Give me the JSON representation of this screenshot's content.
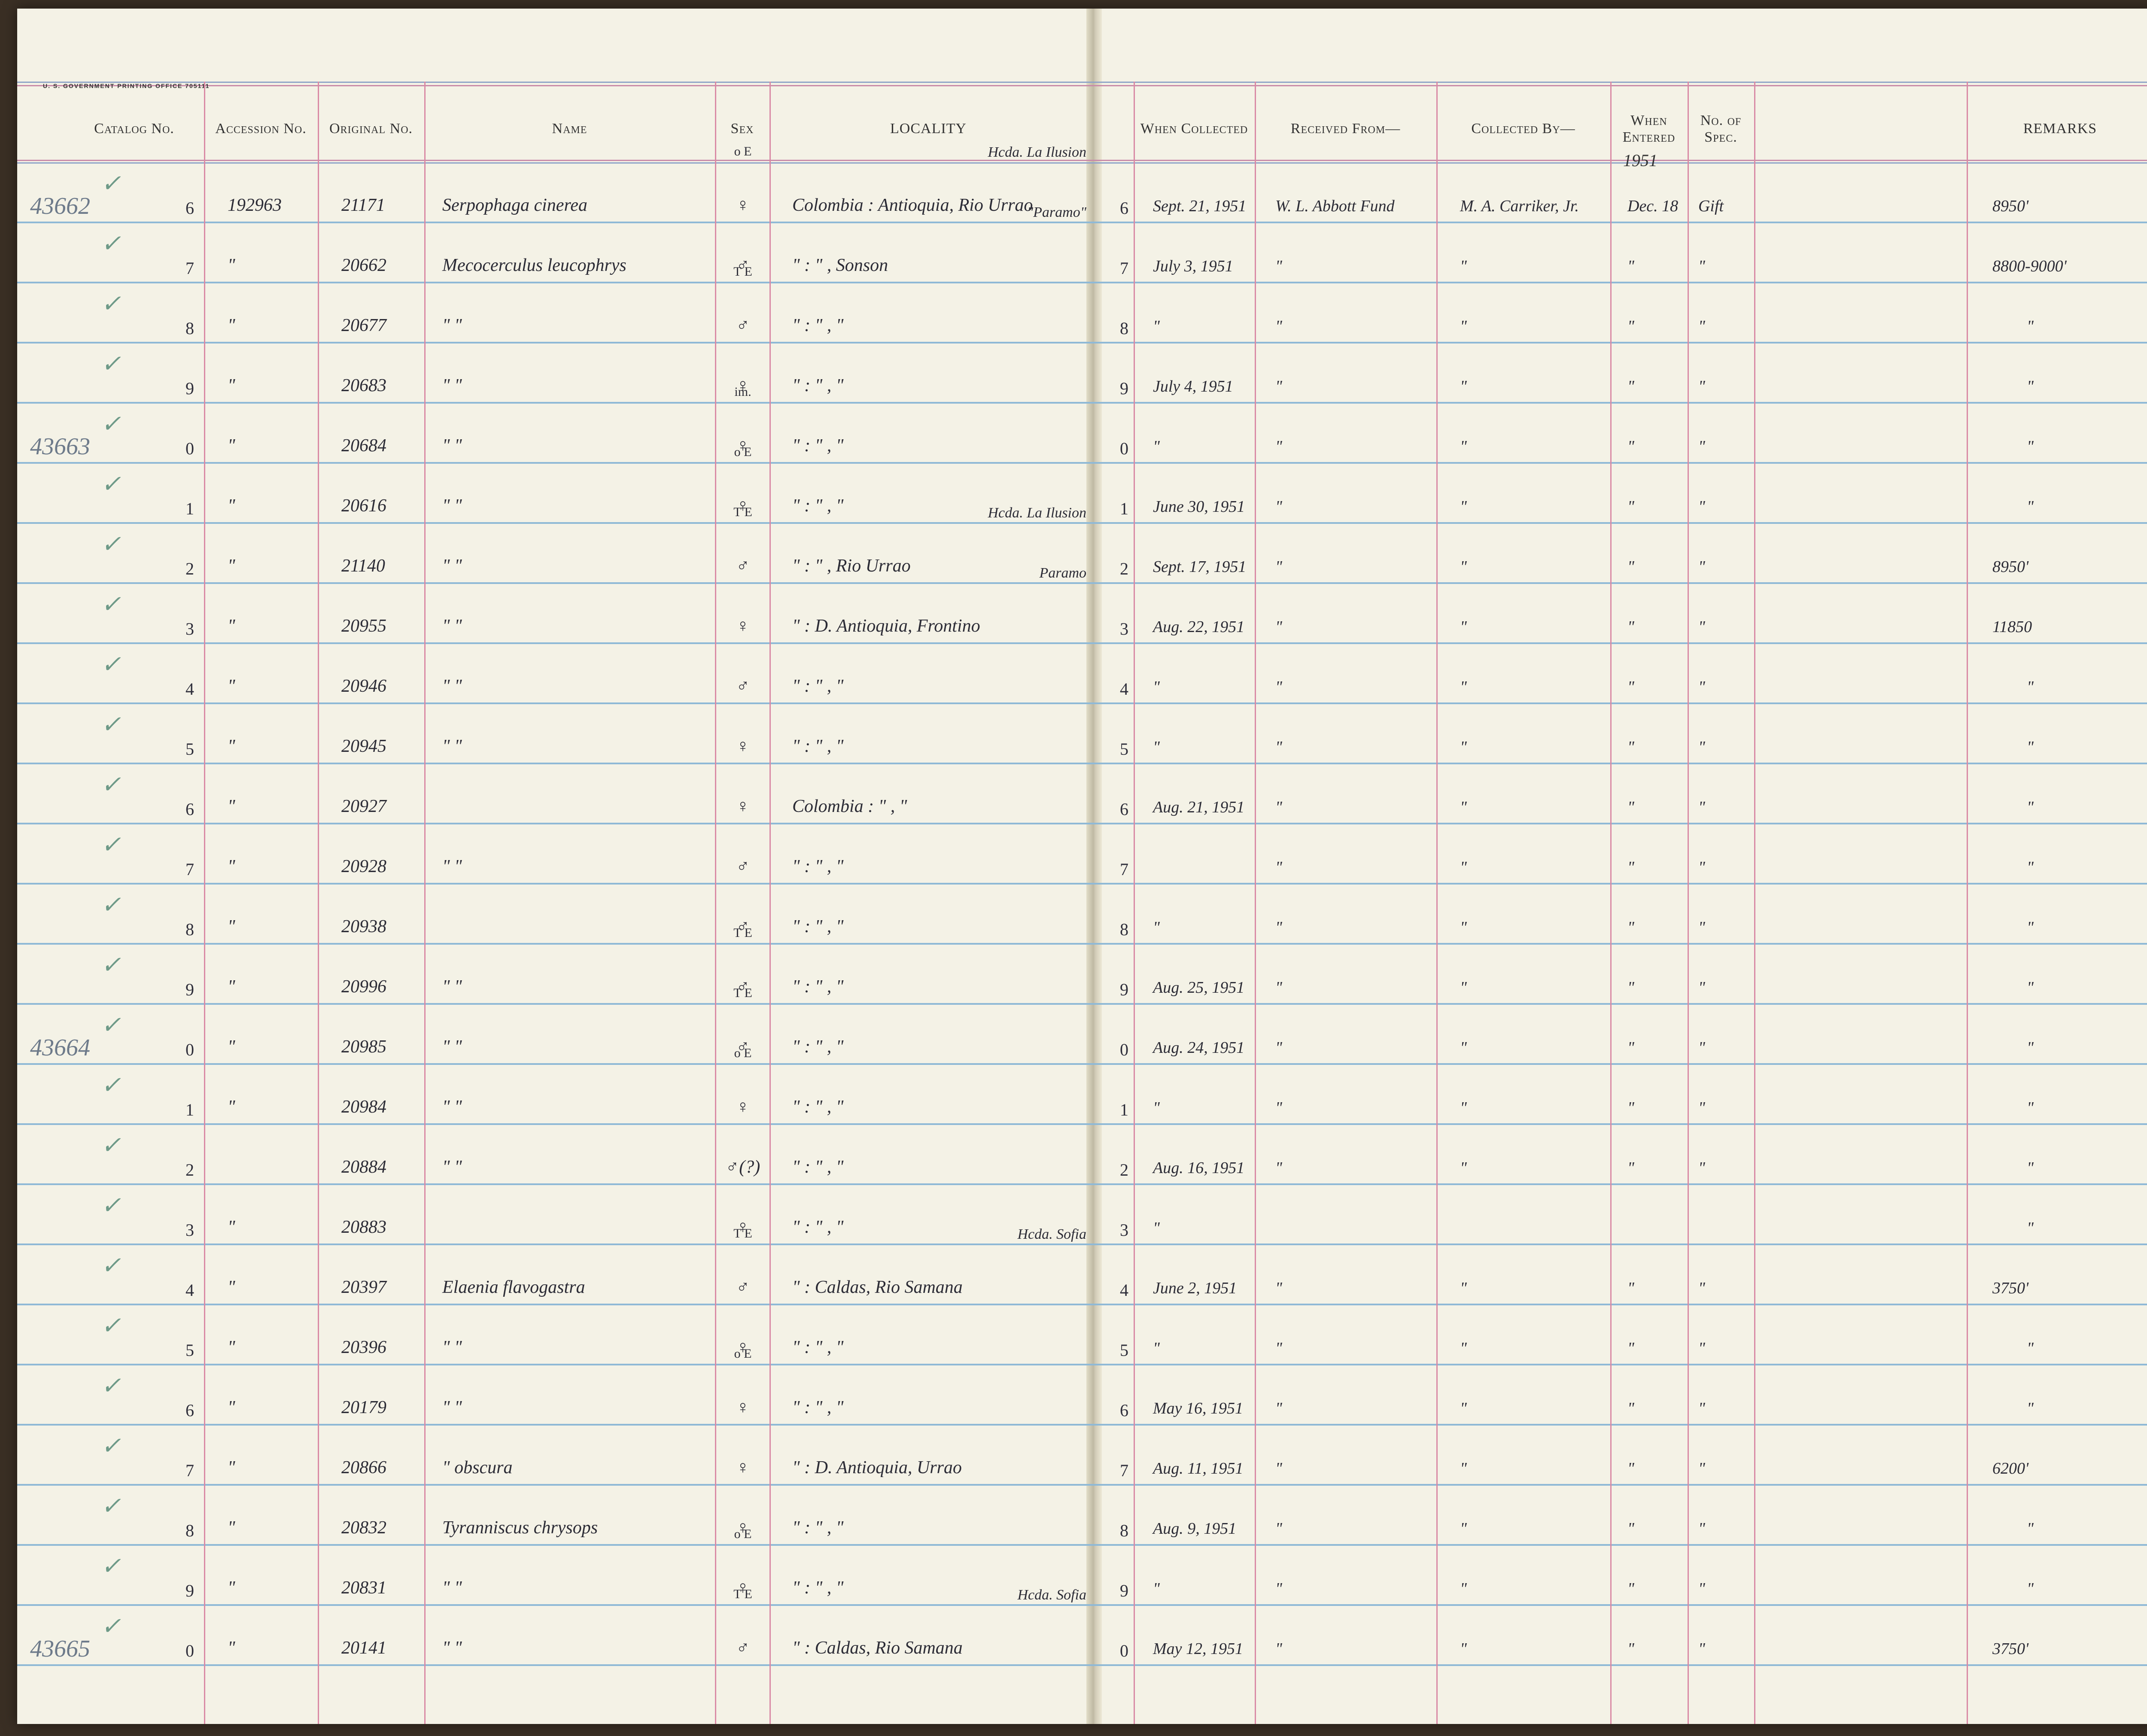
{
  "printer": "U. S. GOVERNMENT PRINTING OFFICE   705111",
  "headers": {
    "catalog": "Catalog No.",
    "accession": "Accession No.",
    "original": "Original No.",
    "name": "Name",
    "sex": "Sex",
    "locality": "LOCALITY",
    "when_collected": "When Collected",
    "received_from": "Received From—",
    "collected_by": "Collected By—",
    "when_entered": "When Entered",
    "no_spec": "No. of Spec.",
    "remarks": "REMARKS"
  },
  "entered_year": "1951",
  "rows": [
    {
      "check": "✓",
      "prefix": "43662",
      "cat": "6",
      "acc": "192963",
      "orig": "21171",
      "name": "Serpophaga cinerea",
      "sex": "♀",
      "sex_note": "o E",
      "loc_note": "Hcda. La Ilusion",
      "locality": "Colombia : Antioquia, Rio Urrao",
      "digit": "6",
      "date": "Sept. 21, 1951",
      "recv": "W. L. Abbott Fund",
      "coll": "M. A. Carriker, Jr.",
      "entered": "Dec. 18",
      "spec": "Gift",
      "remarks": "8950'"
    },
    {
      "check": "✓",
      "prefix": "",
      "cat": "7",
      "acc": "\"",
      "orig": "20662",
      "name": "Mecocerculus leucophrys",
      "sex": "♂",
      "sex_note": "",
      "loc_note": "\"Paramo\"",
      "locality": "\"     :     \" , Sonson",
      "digit": "7",
      "date": "July 3, 1951",
      "recv": "\"",
      "coll": "\"",
      "entered": "\"",
      "spec": "\"",
      "remarks": "8800-9000'"
    },
    {
      "check": "✓",
      "prefix": "",
      "cat": "8",
      "acc": "\"",
      "orig": "20677",
      "name": "\"        \"",
      "sex": "♂",
      "sex_note": "T E",
      "loc_note": "",
      "locality": "\"   :   \" ,   \"",
      "digit": "8",
      "date": "\"",
      "recv": "\"",
      "coll": "\"",
      "entered": "\"",
      "spec": "\"",
      "remarks": "\""
    },
    {
      "check": "✓",
      "prefix": "",
      "cat": "9",
      "acc": "\"",
      "orig": "20683",
      "name": "\"        \"",
      "sex": "♀",
      "sex_note": "",
      "loc_note": "",
      "locality": "\"   :   \" ,   \"",
      "digit": "9",
      "date": "July 4, 1951",
      "recv": "\"",
      "coll": "\"",
      "entered": "\"",
      "spec": "\"",
      "remarks": "\""
    },
    {
      "check": "✓",
      "prefix": "43663",
      "cat": "0",
      "acc": "\"",
      "orig": "20684",
      "name": "\"        \"",
      "sex": "♀",
      "sex_note": "im.",
      "loc_note": "",
      "locality": "\"   :   \" ,   \"",
      "digit": "0",
      "date": "\"",
      "recv": "\"",
      "coll": "\"",
      "entered": "\"",
      "spec": "\"",
      "remarks": "\""
    },
    {
      "check": "✓",
      "prefix": "",
      "cat": "1",
      "acc": "\"",
      "orig": "20616",
      "name": "\"        \"",
      "sex": "♀",
      "sex_note": "o E",
      "loc_note": "",
      "locality": "\"   :   \" ,   \"",
      "digit": "1",
      "date": "June 30, 1951",
      "recv": "\"",
      "coll": "\"",
      "entered": "\"",
      "spec": "\"",
      "remarks": "\""
    },
    {
      "check": "✓",
      "prefix": "",
      "cat": "2",
      "acc": "\"",
      "orig": "21140",
      "name": "\"        \"",
      "sex": "♂",
      "sex_note": "T E",
      "loc_note": "Hcda. La Ilusion",
      "locality": "\"   :   \" , Rio Urrao",
      "digit": "2",
      "date": "Sept. 17, 1951",
      "recv": "\"",
      "coll": "\"",
      "entered": "\"",
      "spec": "\"",
      "remarks": "8950'"
    },
    {
      "check": "✓",
      "prefix": "",
      "cat": "3",
      "acc": "\"",
      "orig": "20955",
      "name": "\"        \"",
      "sex": "♀",
      "sex_note": "",
      "loc_note": "Paramo",
      "locality": "\"  : D. Antioquia, Frontino",
      "digit": "3",
      "date": "Aug. 22, 1951",
      "recv": "\"",
      "coll": "\"",
      "entered": "\"",
      "spec": "\"",
      "remarks": "11850"
    },
    {
      "check": "✓",
      "prefix": "",
      "cat": "4",
      "acc": "\"",
      "orig": "20946",
      "name": "\"        \"",
      "sex": "♂",
      "sex_note": "",
      "loc_note": "",
      "locality": "\"   :   \" ,   \"",
      "digit": "4",
      "date": "\"",
      "recv": "\"",
      "coll": "\"",
      "entered": "\"",
      "spec": "\"",
      "remarks": "\""
    },
    {
      "check": "✓",
      "prefix": "",
      "cat": "5",
      "acc": "\"",
      "orig": "20945",
      "name": "\"        \"",
      "sex": "♀",
      "sex_note": "",
      "loc_note": "",
      "locality": "\"   :   \" ,   \"",
      "digit": "5",
      "date": "\"",
      "recv": "\"",
      "coll": "\"",
      "entered": "\"",
      "spec": "\"",
      "remarks": "\""
    },
    {
      "check": "✓",
      "prefix": "",
      "cat": "6",
      "acc": "\"",
      "orig": "20927",
      "name": "",
      "sex": "♀",
      "sex_note": "",
      "loc_note": "",
      "locality": "Colombia :   \" ,   \"",
      "digit": "6",
      "date": "Aug. 21, 1951",
      "recv": "\"",
      "coll": "\"",
      "entered": "\"",
      "spec": "\"",
      "remarks": "\""
    },
    {
      "check": "✓",
      "prefix": "",
      "cat": "7",
      "acc": "\"",
      "orig": "20928",
      "name": "\"        \"",
      "sex": "♂",
      "sex_note": "",
      "loc_note": "",
      "locality": "\"   :   \" ,   \"",
      "digit": "7",
      "date": "",
      "recv": "\"",
      "coll": "\"",
      "entered": "\"",
      "spec": "\"",
      "remarks": "\""
    },
    {
      "check": "✓",
      "prefix": "",
      "cat": "8",
      "acc": "\"",
      "orig": "20938",
      "name": "",
      "sex": "♂",
      "sex_note": "",
      "loc_note": "",
      "locality": "\"   :   \" ,   \"",
      "digit": "8",
      "date": "\"",
      "recv": "\"",
      "coll": "\"",
      "entered": "\"",
      "spec": "\"",
      "remarks": "\""
    },
    {
      "check": "✓",
      "prefix": "",
      "cat": "9",
      "acc": "\"",
      "orig": "20996",
      "name": "\"        \"",
      "sex": "♂",
      "sex_note": "T E",
      "loc_note": "",
      "locality": "\"   :   \" ,   \"",
      "digit": "9",
      "date": "Aug. 25, 1951",
      "recv": "\"",
      "coll": "\"",
      "entered": "\"",
      "spec": "\"",
      "remarks": "\""
    },
    {
      "check": "✓",
      "prefix": "43664",
      "cat": "0",
      "acc": "\"",
      "orig": "20985",
      "name": "\"        \"",
      "sex": "♂",
      "sex_note": "T E",
      "loc_note": "",
      "locality": "\"   :   \" ,   \"",
      "digit": "0",
      "date": "Aug. 24, 1951",
      "recv": "\"",
      "coll": "\"",
      "entered": "\"",
      "spec": "\"",
      "remarks": "\""
    },
    {
      "check": "✓",
      "prefix": "",
      "cat": "1",
      "acc": "\"",
      "orig": "20984",
      "name": "\"        \"",
      "sex": "♀",
      "sex_note": "o E",
      "loc_note": "",
      "locality": "\"   :   \" ,   \"",
      "digit": "1",
      "date": "\"",
      "recv": "\"",
      "coll": "\"",
      "entered": "\"",
      "spec": "\"",
      "remarks": "\""
    },
    {
      "check": "✓",
      "prefix": "",
      "cat": "2",
      "acc": "",
      "orig": "20884",
      "name": "\"        \"",
      "sex": "♂(?)",
      "sex_note": "",
      "loc_note": "",
      "locality": "\"   :   \" ,   \"",
      "digit": "2",
      "date": "Aug. 16, 1951",
      "recv": "\"",
      "coll": "\"",
      "entered": "\"",
      "spec": "\"",
      "remarks": "\""
    },
    {
      "check": "✓",
      "prefix": "",
      "cat": "3",
      "acc": "\"",
      "orig": "20883",
      "name": "",
      "sex": "♀",
      "sex_note": "",
      "loc_note": "",
      "locality": "\"   :   \" ,   \"",
      "digit": "3",
      "date": "\"",
      "recv": "",
      "coll": "",
      "entered": "",
      "spec": "",
      "remarks": "\""
    },
    {
      "check": "✓",
      "prefix": "",
      "cat": "4",
      "acc": "\"",
      "orig": "20397",
      "name": "Elaenia flavogastra",
      "sex": "♂",
      "sex_note": "T E",
      "loc_note": "Hcda. Sofia",
      "locality": "\"  :  Caldas, Rio Samana",
      "digit": "4",
      "date": "June 2, 1951",
      "recv": "\"",
      "coll": "\"",
      "entered": "\"",
      "spec": "\"",
      "remarks": "3750'"
    },
    {
      "check": "✓",
      "prefix": "",
      "cat": "5",
      "acc": "\"",
      "orig": "20396",
      "name": "\"        \"",
      "sex": "♀",
      "sex_note": "",
      "loc_note": "",
      "locality": "\"   :   \" ,   \"",
      "digit": "5",
      "date": "\"",
      "recv": "\"",
      "coll": "\"",
      "entered": "\"",
      "spec": "\"",
      "remarks": "\""
    },
    {
      "check": "✓",
      "prefix": "",
      "cat": "6",
      "acc": "\"",
      "orig": "20179",
      "name": "\"        \"",
      "sex": "♀",
      "sex_note": "o E",
      "loc_note": "",
      "locality": "\"   :   \" ,   \"",
      "digit": "6",
      "date": "May 16, 1951",
      "recv": "\"",
      "coll": "\"",
      "entered": "\"",
      "spec": "\"",
      "remarks": "\""
    },
    {
      "check": "✓",
      "prefix": "",
      "cat": "7",
      "acc": "\"",
      "orig": "20866",
      "name": "\"  obscura",
      "sex": "♀",
      "sex_note": "",
      "loc_note": "",
      "locality": "\"  : D. Antioquia, Urrao",
      "digit": "7",
      "date": "Aug. 11, 1951",
      "recv": "\"",
      "coll": "\"",
      "entered": "\"",
      "spec": "\"",
      "remarks": "6200'"
    },
    {
      "check": "✓",
      "prefix": "",
      "cat": "8",
      "acc": "\"",
      "orig": "20832",
      "name": "Tyranniscus chrysops",
      "sex": "♀",
      "sex_note": "",
      "loc_note": "",
      "locality": "\"   :   \" ,   \"",
      "digit": "8",
      "date": "Aug. 9, 1951",
      "recv": "\"",
      "coll": "\"",
      "entered": "\"",
      "spec": "\"",
      "remarks": "\""
    },
    {
      "check": "✓",
      "prefix": "",
      "cat": "9",
      "acc": "\"",
      "orig": "20831",
      "name": "\"        \"",
      "sex": "♀",
      "sex_note": "o E",
      "loc_note": "",
      "locality": "\"   :   \" ,   \"",
      "digit": "9",
      "date": "\"",
      "recv": "\"",
      "coll": "\"",
      "entered": "\"",
      "spec": "\"",
      "remarks": "\""
    },
    {
      "check": "✓",
      "prefix": "43665",
      "cat": "0",
      "acc": "\"",
      "orig": "20141",
      "name": "\"        \"",
      "sex": "♂",
      "sex_note": "T E",
      "loc_note": "Hcda. Sofia",
      "locality": "\"  :  Caldas, Rio Samana",
      "digit": "0",
      "date": "May 12, 1951",
      "recv": "\"",
      "coll": "\"",
      "entered": "\"",
      "spec": "\"",
      "remarks": "3750'"
    }
  ]
}
